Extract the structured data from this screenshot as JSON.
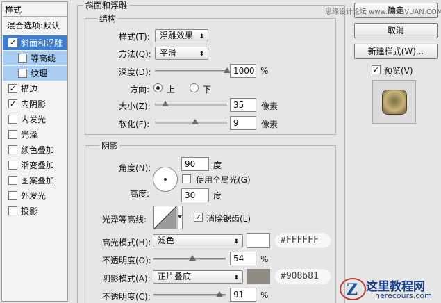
{
  "watermark_top": "思缘设计论坛 www.MISSVUAN.COM",
  "watermark_bottom": {
    "title": "这里教程网",
    "url": "herecours.com"
  },
  "sidebar": {
    "title": "样式",
    "items": [
      {
        "label": "混合选项:默认",
        "checkbox": false,
        "state": "header"
      },
      {
        "label": "斜面和浮雕",
        "checkbox": true,
        "checked": "✓",
        "state": "selected"
      },
      {
        "label": "等高线",
        "checkbox": true,
        "checked": "",
        "state": "sub"
      },
      {
        "label": "纹理",
        "checkbox": true,
        "checked": "",
        "state": "sub"
      },
      {
        "label": "描边",
        "checkbox": true,
        "checked": "✓",
        "state": "normal"
      },
      {
        "label": "内阴影",
        "checkbox": true,
        "checked": "✓",
        "state": "normal"
      },
      {
        "label": "内发光",
        "checkbox": true,
        "checked": "",
        "state": "normal"
      },
      {
        "label": "光泽",
        "checkbox": true,
        "checked": "",
        "state": "normal"
      },
      {
        "label": "颜色叠加",
        "checkbox": true,
        "checked": "",
        "state": "normal"
      },
      {
        "label": "渐变叠加",
        "checkbox": true,
        "checked": "",
        "state": "normal"
      },
      {
        "label": "图案叠加",
        "checkbox": true,
        "checked": "",
        "state": "normal"
      },
      {
        "label": "外发光",
        "checkbox": true,
        "checked": "",
        "state": "normal"
      },
      {
        "label": "投影",
        "checkbox": true,
        "checked": "",
        "state": "normal"
      }
    ]
  },
  "bevel": {
    "group_title": "斜面和浮雕",
    "structure": {
      "title": "结构",
      "style_label": "样式(T):",
      "style_value": "浮雕效果",
      "technique_label": "方法(Q):",
      "technique_value": "平滑",
      "depth_label": "深度(D):",
      "depth_value": "1000",
      "depth_unit": "%",
      "depth_fraction": 1.0,
      "direction_label": "方向:",
      "direction_up": "上",
      "direction_down": "下",
      "size_label": "大小(Z):",
      "size_value": "35",
      "size_unit": "像素",
      "size_fraction": 0.14,
      "soften_label": "软化(F):",
      "soften_value": "9",
      "soften_unit": "像素",
      "soften_fraction": 0.56
    },
    "shading": {
      "title": "阴影",
      "angle_label": "角度(N):",
      "angle_value": "90",
      "angle_unit": "度",
      "global_light_label": "使用全局光(G)",
      "global_light_checked": "",
      "altitude_label": "高度:",
      "altitude_value": "30",
      "altitude_unit": "度",
      "gloss_label": "光泽等高线:",
      "antialias_label": "消除锯齿(L)",
      "antialias_checked": "✓",
      "highlight_mode_label": "高光模式(H):",
      "highlight_mode_value": "滤色",
      "highlight_color": "#FFFFFF",
      "highlight_hex_label": "#FFFFFF",
      "highlight_opacity_label": "不透明度(O):",
      "highlight_opacity_value": "54",
      "highlight_opacity_unit": "%",
      "highlight_opacity_fraction": 0.54,
      "shadow_mode_label": "阴影模式(A):",
      "shadow_mode_value": "正片叠底",
      "shadow_color": "#908b81",
      "shadow_hex_label": "#908b81",
      "shadow_opacity_label": "不透明度(C):",
      "shadow_opacity_value": "91",
      "shadow_opacity_unit": "%",
      "shadow_opacity_fraction": 0.91
    }
  },
  "buttons": {
    "ok": "确定",
    "cancel": "取消",
    "new_style": "新建样式(W)...",
    "preview_label": "预览(V)",
    "preview_checked": "✓"
  }
}
